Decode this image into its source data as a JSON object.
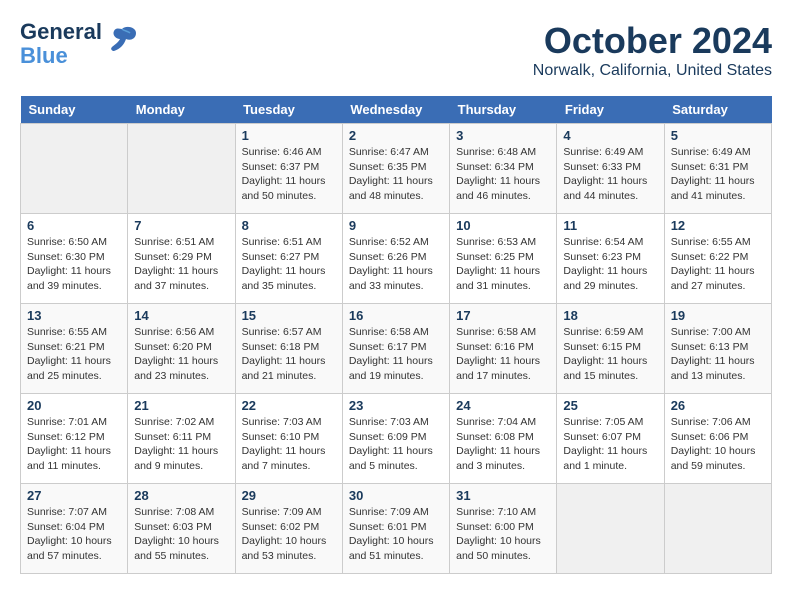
{
  "logo": {
    "name_part1": "General",
    "name_part2": "Blue"
  },
  "header": {
    "title": "October 2024",
    "location": "Norwalk, California, United States"
  },
  "weekdays": [
    "Sunday",
    "Monday",
    "Tuesday",
    "Wednesday",
    "Thursday",
    "Friday",
    "Saturday"
  ],
  "weeks": [
    [
      {
        "day": "",
        "empty": true
      },
      {
        "day": "",
        "empty": true
      },
      {
        "day": "1",
        "sunrise": "Sunrise: 6:46 AM",
        "sunset": "Sunset: 6:37 PM",
        "daylight": "Daylight: 11 hours and 50 minutes."
      },
      {
        "day": "2",
        "sunrise": "Sunrise: 6:47 AM",
        "sunset": "Sunset: 6:35 PM",
        "daylight": "Daylight: 11 hours and 48 minutes."
      },
      {
        "day": "3",
        "sunrise": "Sunrise: 6:48 AM",
        "sunset": "Sunset: 6:34 PM",
        "daylight": "Daylight: 11 hours and 46 minutes."
      },
      {
        "day": "4",
        "sunrise": "Sunrise: 6:49 AM",
        "sunset": "Sunset: 6:33 PM",
        "daylight": "Daylight: 11 hours and 44 minutes."
      },
      {
        "day": "5",
        "sunrise": "Sunrise: 6:49 AM",
        "sunset": "Sunset: 6:31 PM",
        "daylight": "Daylight: 11 hours and 41 minutes."
      }
    ],
    [
      {
        "day": "6",
        "sunrise": "Sunrise: 6:50 AM",
        "sunset": "Sunset: 6:30 PM",
        "daylight": "Daylight: 11 hours and 39 minutes."
      },
      {
        "day": "7",
        "sunrise": "Sunrise: 6:51 AM",
        "sunset": "Sunset: 6:29 PM",
        "daylight": "Daylight: 11 hours and 37 minutes."
      },
      {
        "day": "8",
        "sunrise": "Sunrise: 6:51 AM",
        "sunset": "Sunset: 6:27 PM",
        "daylight": "Daylight: 11 hours and 35 minutes."
      },
      {
        "day": "9",
        "sunrise": "Sunrise: 6:52 AM",
        "sunset": "Sunset: 6:26 PM",
        "daylight": "Daylight: 11 hours and 33 minutes."
      },
      {
        "day": "10",
        "sunrise": "Sunrise: 6:53 AM",
        "sunset": "Sunset: 6:25 PM",
        "daylight": "Daylight: 11 hours and 31 minutes."
      },
      {
        "day": "11",
        "sunrise": "Sunrise: 6:54 AM",
        "sunset": "Sunset: 6:23 PM",
        "daylight": "Daylight: 11 hours and 29 minutes."
      },
      {
        "day": "12",
        "sunrise": "Sunrise: 6:55 AM",
        "sunset": "Sunset: 6:22 PM",
        "daylight": "Daylight: 11 hours and 27 minutes."
      }
    ],
    [
      {
        "day": "13",
        "sunrise": "Sunrise: 6:55 AM",
        "sunset": "Sunset: 6:21 PM",
        "daylight": "Daylight: 11 hours and 25 minutes."
      },
      {
        "day": "14",
        "sunrise": "Sunrise: 6:56 AM",
        "sunset": "Sunset: 6:20 PM",
        "daylight": "Daylight: 11 hours and 23 minutes."
      },
      {
        "day": "15",
        "sunrise": "Sunrise: 6:57 AM",
        "sunset": "Sunset: 6:18 PM",
        "daylight": "Daylight: 11 hours and 21 minutes."
      },
      {
        "day": "16",
        "sunrise": "Sunrise: 6:58 AM",
        "sunset": "Sunset: 6:17 PM",
        "daylight": "Daylight: 11 hours and 19 minutes."
      },
      {
        "day": "17",
        "sunrise": "Sunrise: 6:58 AM",
        "sunset": "Sunset: 6:16 PM",
        "daylight": "Daylight: 11 hours and 17 minutes."
      },
      {
        "day": "18",
        "sunrise": "Sunrise: 6:59 AM",
        "sunset": "Sunset: 6:15 PM",
        "daylight": "Daylight: 11 hours and 15 minutes."
      },
      {
        "day": "19",
        "sunrise": "Sunrise: 7:00 AM",
        "sunset": "Sunset: 6:13 PM",
        "daylight": "Daylight: 11 hours and 13 minutes."
      }
    ],
    [
      {
        "day": "20",
        "sunrise": "Sunrise: 7:01 AM",
        "sunset": "Sunset: 6:12 PM",
        "daylight": "Daylight: 11 hours and 11 minutes."
      },
      {
        "day": "21",
        "sunrise": "Sunrise: 7:02 AM",
        "sunset": "Sunset: 6:11 PM",
        "daylight": "Daylight: 11 hours and 9 minutes."
      },
      {
        "day": "22",
        "sunrise": "Sunrise: 7:03 AM",
        "sunset": "Sunset: 6:10 PM",
        "daylight": "Daylight: 11 hours and 7 minutes."
      },
      {
        "day": "23",
        "sunrise": "Sunrise: 7:03 AM",
        "sunset": "Sunset: 6:09 PM",
        "daylight": "Daylight: 11 hours and 5 minutes."
      },
      {
        "day": "24",
        "sunrise": "Sunrise: 7:04 AM",
        "sunset": "Sunset: 6:08 PM",
        "daylight": "Daylight: 11 hours and 3 minutes."
      },
      {
        "day": "25",
        "sunrise": "Sunrise: 7:05 AM",
        "sunset": "Sunset: 6:07 PM",
        "daylight": "Daylight: 11 hours and 1 minute."
      },
      {
        "day": "26",
        "sunrise": "Sunrise: 7:06 AM",
        "sunset": "Sunset: 6:06 PM",
        "daylight": "Daylight: 10 hours and 59 minutes."
      }
    ],
    [
      {
        "day": "27",
        "sunrise": "Sunrise: 7:07 AM",
        "sunset": "Sunset: 6:04 PM",
        "daylight": "Daylight: 10 hours and 57 minutes."
      },
      {
        "day": "28",
        "sunrise": "Sunrise: 7:08 AM",
        "sunset": "Sunset: 6:03 PM",
        "daylight": "Daylight: 10 hours and 55 minutes."
      },
      {
        "day": "29",
        "sunrise": "Sunrise: 7:09 AM",
        "sunset": "Sunset: 6:02 PM",
        "daylight": "Daylight: 10 hours and 53 minutes."
      },
      {
        "day": "30",
        "sunrise": "Sunrise: 7:09 AM",
        "sunset": "Sunset: 6:01 PM",
        "daylight": "Daylight: 10 hours and 51 minutes."
      },
      {
        "day": "31",
        "sunrise": "Sunrise: 7:10 AM",
        "sunset": "Sunset: 6:00 PM",
        "daylight": "Daylight: 10 hours and 50 minutes."
      },
      {
        "day": "",
        "empty": true
      },
      {
        "day": "",
        "empty": true
      }
    ]
  ]
}
